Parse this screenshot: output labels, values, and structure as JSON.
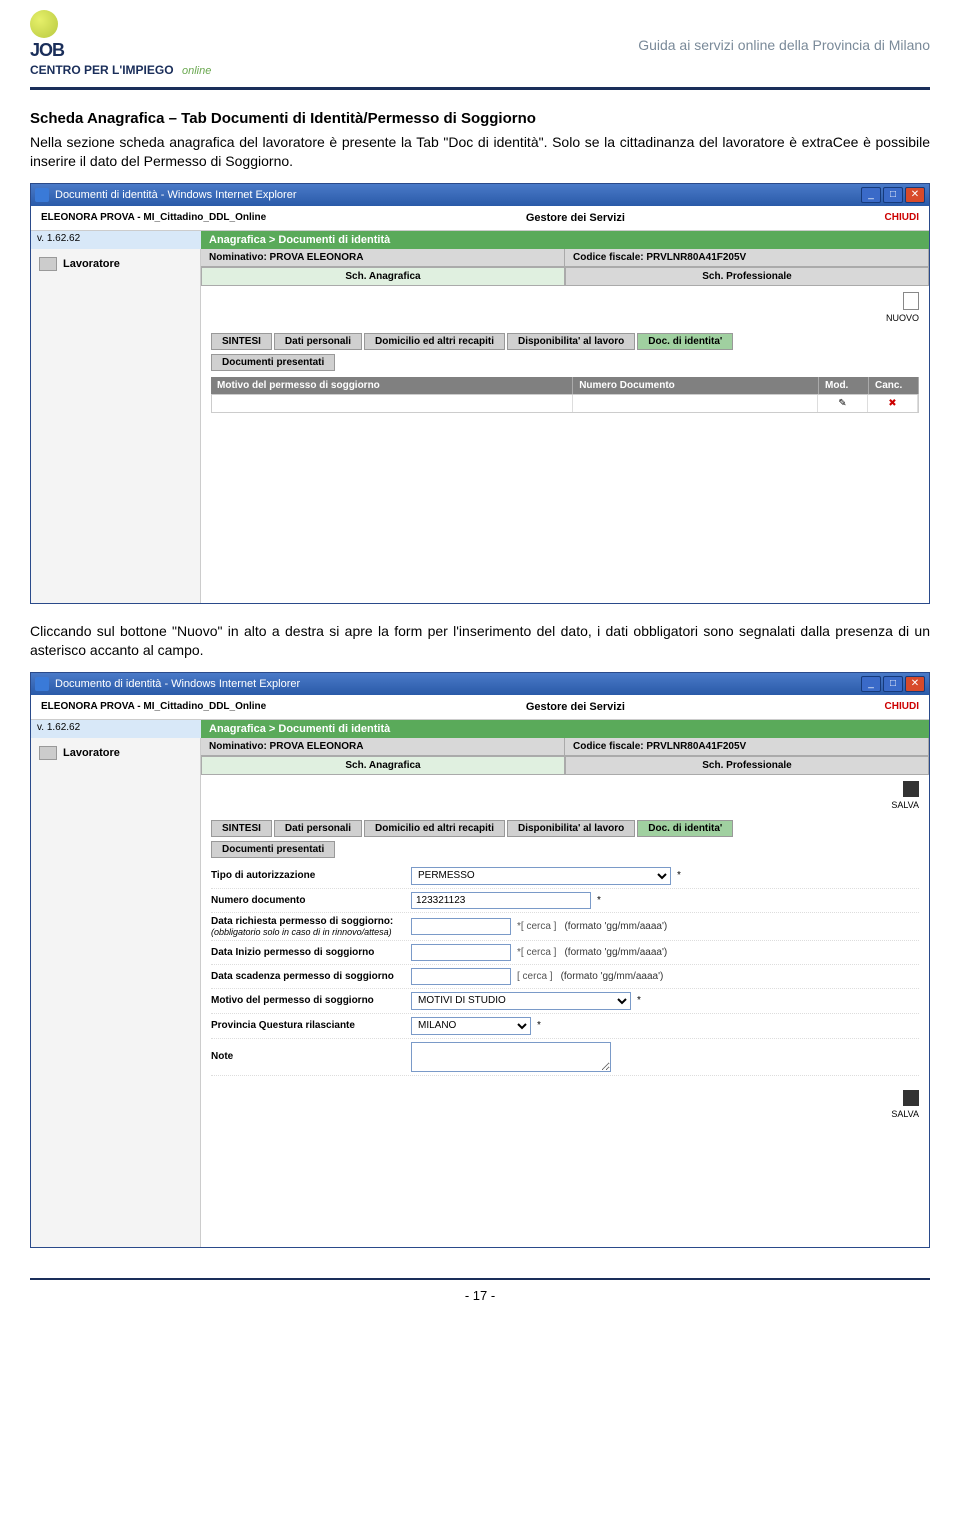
{
  "header": {
    "logo_main": "JOB",
    "logo_sub": "CENTRO PER L'IMPIEGO",
    "logo_online": "online",
    "right_text": "Guida ai servizi online della Provincia di Milano"
  },
  "section": {
    "title": "Scheda Anagrafica – Tab Documenti di Identità/Permesso di Soggiorno",
    "para1": "Nella sezione scheda anagrafica del lavoratore è presente la Tab \"Doc di identità\". Solo se la cittadinanza del lavoratore è extraCee è possibile inserire il dato del Permesso di Soggiorno.",
    "para2": "Cliccando sul bottone \"Nuovo\" in alto a destra si apre la form per l'inserimento del dato, i dati obbligatori sono segnalati dalla presenza di un asterisco accanto al campo."
  },
  "screenshot1": {
    "window_title": "Documenti di identità - Windows Internet Explorer",
    "user": "ELEONORA PROVA - MI_Cittadino_DDL_Online",
    "gestore": "Gestore dei Servizi",
    "chiudi": "CHIUDI",
    "version": "v. 1.62.62",
    "breadcrumb": "Anagrafica > Documenti di identità",
    "sidebar_item": "Lavoratore",
    "nominativo_label": "Nominativo: PROVA  ELEONORA",
    "cf_label": "Codice fiscale: PRVLNR80A41F205V",
    "sch_anag": "Sch. Anagrafica",
    "sch_prof": "Sch. Professionale",
    "nuovo": "NUOVO",
    "subtabs": [
      "SINTESI",
      "Dati personali",
      "Domicilio ed altri recapiti",
      "Disponibilita' al lavoro",
      "Doc. di identita'"
    ],
    "subtab2": "Documenti presentati",
    "thead": {
      "motivo": "Motivo del permesso di soggiorno",
      "numero": "Numero Documento",
      "mod": "Mod.",
      "canc": "Canc."
    }
  },
  "screenshot2": {
    "window_title": "Documento di identità - Windows Internet Explorer",
    "user": "ELEONORA PROVA - MI_Cittadino_DDL_Online",
    "gestore": "Gestore dei Servizi",
    "chiudi": "CHIUDI",
    "version": "v. 1.62.62",
    "breadcrumb": "Anagrafica > Documenti di identità",
    "sidebar_item": "Lavoratore",
    "nominativo_label": "Nominativo: PROVA  ELEONORA",
    "cf_label": "Codice fiscale: PRVLNR80A41F205V",
    "sch_anag": "Sch. Anagrafica",
    "sch_prof": "Sch. Professionale",
    "salva_top": "SALVA",
    "subtabs": [
      "SINTESI",
      "Dati personali",
      "Domicilio ed altri recapiti",
      "Disponibilita' al lavoro",
      "Doc. di identita'"
    ],
    "subtab2": "Documenti presentati",
    "form": {
      "tipo_label": "Tipo di autorizzazione",
      "tipo_value": "PERMESSO",
      "numero_label": "Numero documento",
      "numero_value": "123321123",
      "data_rich_label": "Data richiesta permesso di soggiorno:",
      "data_rich_sub": "(obbligatorio solo in caso di in rinnovo/attesa)",
      "data_inizio_label": "Data Inizio permesso di soggiorno",
      "data_scad_label": "Data scadenza permesso di soggiorno",
      "motivo_label": "Motivo del permesso di soggiorno",
      "motivo_value": "MOTIVI DI STUDIO",
      "provincia_label": "Provincia Questura rilasciante",
      "provincia_value": "MILANO",
      "note_label": "Note",
      "cerca": "*[ cerca ]",
      "cerca_plain": "[ cerca ]",
      "hint": "(formato 'gg/mm/aaaa')",
      "asterisk": "*"
    },
    "salva": "SALVA"
  },
  "footer": {
    "page": "- 17 -"
  }
}
